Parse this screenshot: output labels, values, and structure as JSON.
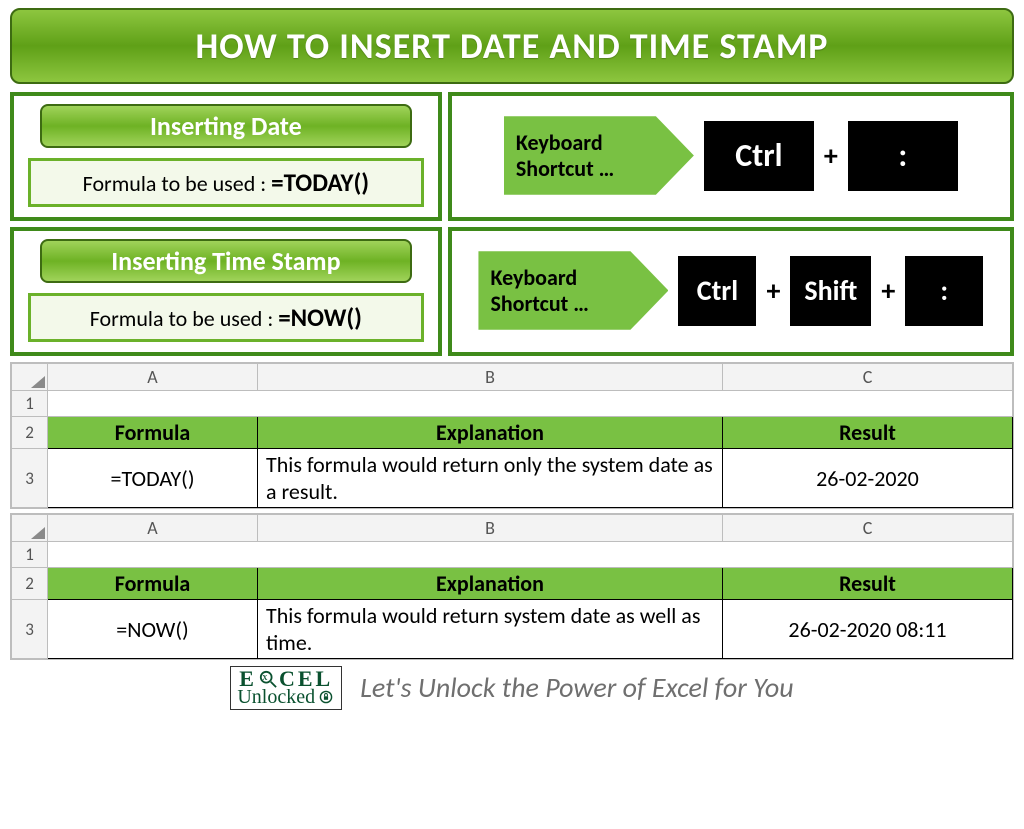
{
  "title": "HOW TO INSERT DATE AND TIME STAMP",
  "sections": [
    {
      "heading": "Inserting Date",
      "formula_label": "Formula to be used : ",
      "formula": "=TODAY()",
      "shortcut_label": "Keyboard Shortcut …",
      "keys": [
        "Ctrl",
        ":"
      ]
    },
    {
      "heading": "Inserting Time Stamp",
      "formula_label": "Formula to be used : ",
      "formula": "=NOW()",
      "shortcut_label": "Keyboard Shortcut …",
      "keys": [
        "Ctrl",
        "Shift",
        ":"
      ]
    }
  ],
  "tables": [
    {
      "columns": [
        "A",
        "B",
        "C"
      ],
      "row_numbers": [
        "1",
        "2",
        "3"
      ],
      "headers": [
        "Formula",
        "Explanation",
        "Result"
      ],
      "data": [
        "=TODAY()",
        "This formula would return only the system date as a result.",
        "26-02-2020"
      ]
    },
    {
      "columns": [
        "A",
        "B",
        "C"
      ],
      "row_numbers": [
        "1",
        "2",
        "3"
      ],
      "headers": [
        "Formula",
        "Explanation",
        "Result"
      ],
      "data": [
        "=NOW()",
        "This formula would return system date as well as time.",
        "26-02-2020 08:11"
      ]
    }
  ],
  "footer": {
    "brand_line1": "EXCEL",
    "brand_line2": "Unlocked",
    "tagline": "Let's Unlock the Power of Excel for You"
  }
}
